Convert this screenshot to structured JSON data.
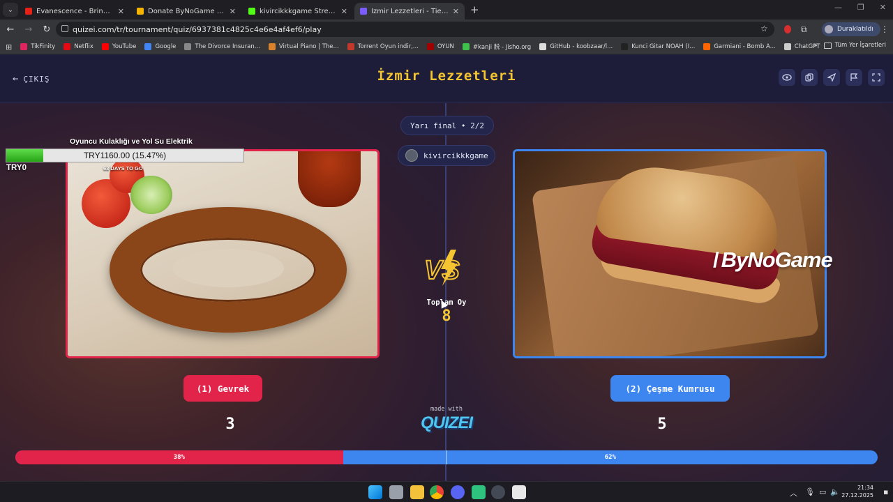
{
  "browser": {
    "tabs": [
      {
        "title": "Evanescence - Bring Me To Life",
        "color": "#e62117",
        "active": false
      },
      {
        "title": "Donate ByNoGame - Streamer",
        "color": "#f4b400",
        "active": false
      },
      {
        "title": "kivircikkkgame Stream - Watch",
        "color": "#53fc18",
        "active": false
      },
      {
        "title": "İzmir Lezzetleri - Tier List, Kör S",
        "color": "#7a5cff",
        "active": true
      }
    ],
    "url": "quizei.com/tr/tournament/quiz/6937381c4825c4e6e4af4ef6/play",
    "profile_label": "Duraklatıldı",
    "bookmarks": [
      {
        "label": "TikFinity",
        "color": "#e0245e"
      },
      {
        "label": "Netflix",
        "color": "#e50914"
      },
      {
        "label": "YouTube",
        "color": "#ff0000"
      },
      {
        "label": "Google",
        "color": "#4285f4"
      },
      {
        "label": "The Divorce Insuran...",
        "color": "#888888"
      },
      {
        "label": "Virtual Piano | The...",
        "color": "#d9822b"
      },
      {
        "label": "Torrent Oyun indir,...",
        "color": "#c0392b"
      },
      {
        "label": "OYUN",
        "color": "#a00000"
      },
      {
        "label": "#kanji 脱 - Jisho.org",
        "color": "#3ec14b"
      },
      {
        "label": "GitHub - koobzaar/l...",
        "color": "#dddddd"
      },
      {
        "label": "Kunci Gitar NOAH (I...",
        "color": "#222222"
      },
      {
        "label": "Garmiani - Bomb A...",
        "color": "#ff6600"
      },
      {
        "label": "ChatGPT",
        "color": "#cccccc"
      }
    ],
    "bookmarks_folder": "Tüm Yer İşaretleri"
  },
  "header": {
    "exit_label": "ÇIKIŞ",
    "title": "İzmir Lezzetleri"
  },
  "round": {
    "stage": "Yarı final • 2/2",
    "streamer": "kivircikkkgame"
  },
  "donation": {
    "title": "Oyuncu Kulaklığı ve Yol Su Elektrik",
    "amount": "TRY1160.00 (15.47%)",
    "progress": 0.1547,
    "start_label": "TRY0",
    "days_left": "63 DAYS TO GO"
  },
  "watermark": "ByNoGame",
  "vs": {
    "total_label": "Toplam Oy",
    "total_value": "8"
  },
  "left": {
    "name": "(1) Gevrek",
    "votes": "3",
    "percent_label": "38%",
    "percent": 0.38,
    "color": "#e3244a"
  },
  "right": {
    "name": "(2) Çeşme Kumrusu",
    "votes": "5",
    "percent_label": "62%",
    "percent": 0.62,
    "color": "#3d86f0"
  },
  "footer": {
    "made_with": "made with",
    "brand": "QUIZEI"
  },
  "taskbar": {
    "time": "21:34",
    "date": "27.12.2025"
  }
}
